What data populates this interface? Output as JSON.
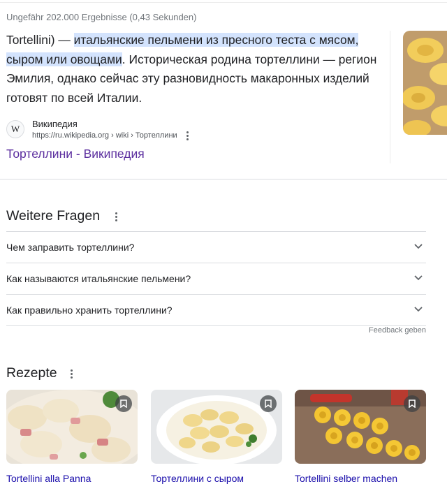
{
  "stats": "Ungefähr 202.000 Ergebnisse (0,43 Sekunden)",
  "snippet": {
    "before": "Tortellini) — ",
    "highlight_line1": "итальянские пельмени из пресного теста с мясом,",
    "highlight_line2": "сыром или овощами",
    "after": ". Историческая родина тортеллини — регион Эмилия, однако сейчас эту разновидность макаронных изделий готовят по всей Италии."
  },
  "source": {
    "favicon": "W",
    "name": "Википедия",
    "url": "https://ru.wikipedia.org › wiki › Тортеллини",
    "link_title": "Тортеллини - Википедия"
  },
  "questions": {
    "title": "Weitere Fragen",
    "items": [
      "Чем заправить тортеллини?",
      "Как называются итальянские пельмени?",
      "Как правильно хранить тортеллини?"
    ],
    "feedback": "Feedback geben"
  },
  "recipes": {
    "title": "Rezepte",
    "cards": [
      {
        "title": "Tortellini alla Panna"
      },
      {
        "title": "Тортеллини с сыром"
      },
      {
        "title": "Tortellini selber machen"
      }
    ]
  },
  "icons": {
    "more": "more-vert-icon",
    "chevron": "chevron-down-icon",
    "bookmark": "bookmark-icon",
    "favicon": "wikipedia-w-icon"
  },
  "colors": {
    "highlight": "#d3e3fd",
    "visited_link": "#5c2f9f",
    "link": "#1a0dab",
    "divider": "#dadce0"
  }
}
